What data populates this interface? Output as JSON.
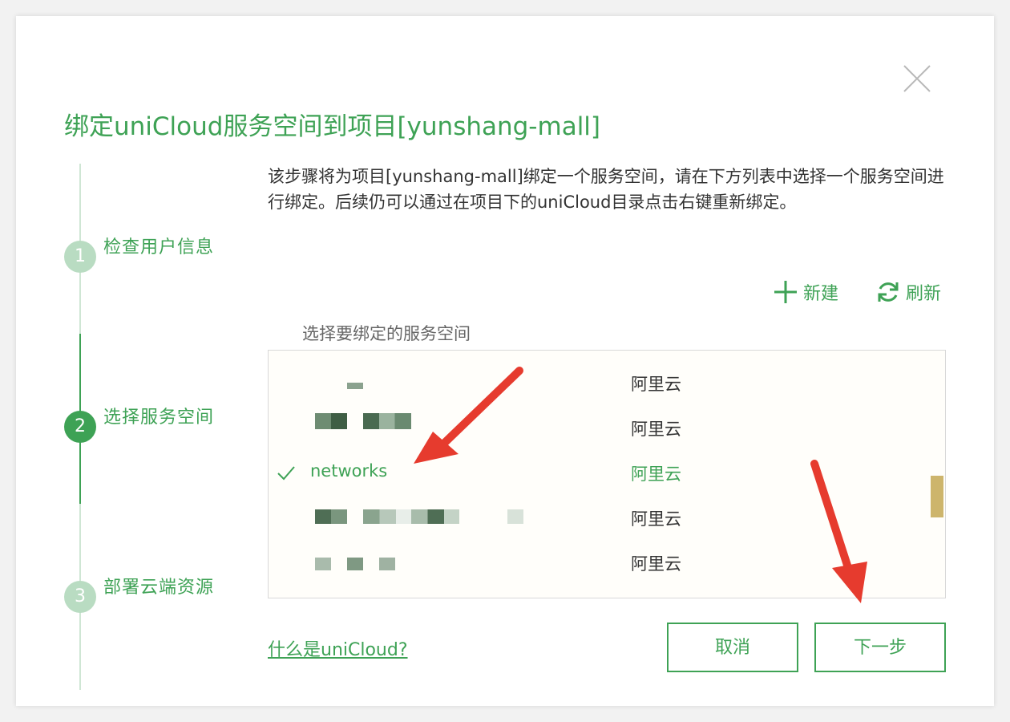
{
  "dialog": {
    "title": "绑定uniCloud服务空间到项目[yunshang-mall]",
    "close_icon": "close-icon"
  },
  "steps": [
    {
      "number": "1",
      "label": "检查用户信息",
      "active": false
    },
    {
      "number": "2",
      "label": "选择服务空间",
      "active": true
    },
    {
      "number": "3",
      "label": "部署云端资源",
      "active": false
    }
  ],
  "description": "该步骤将为项目[yunshang-mall]绑定一个服务空间，请在下方列表中选择一个服务空间进行绑定。后续仍可以通过在项目下的uniCloud目录点击右键重新绑定。",
  "toolbar": {
    "new_label": "新建",
    "new_icon": "plus-icon",
    "refresh_label": "刷新",
    "refresh_icon": "refresh-icon"
  },
  "list": {
    "label": "选择要绑定的服务空间",
    "rows": [
      {
        "name": "",
        "provider": "阿里云",
        "selected": false
      },
      {
        "name": "",
        "provider": "阿里云",
        "selected": false
      },
      {
        "name": "networks",
        "provider": "阿里云",
        "selected": true
      },
      {
        "name": "",
        "provider": "阿里云",
        "selected": false
      },
      {
        "name": "",
        "provider": "阿里云",
        "selected": false
      }
    ]
  },
  "footer": {
    "help_link": "什么是uniCloud?",
    "cancel_label": "取消",
    "next_label": "下一步"
  },
  "colors": {
    "accent": "#3ea255",
    "annotation_arrow": "#e63b2e"
  }
}
